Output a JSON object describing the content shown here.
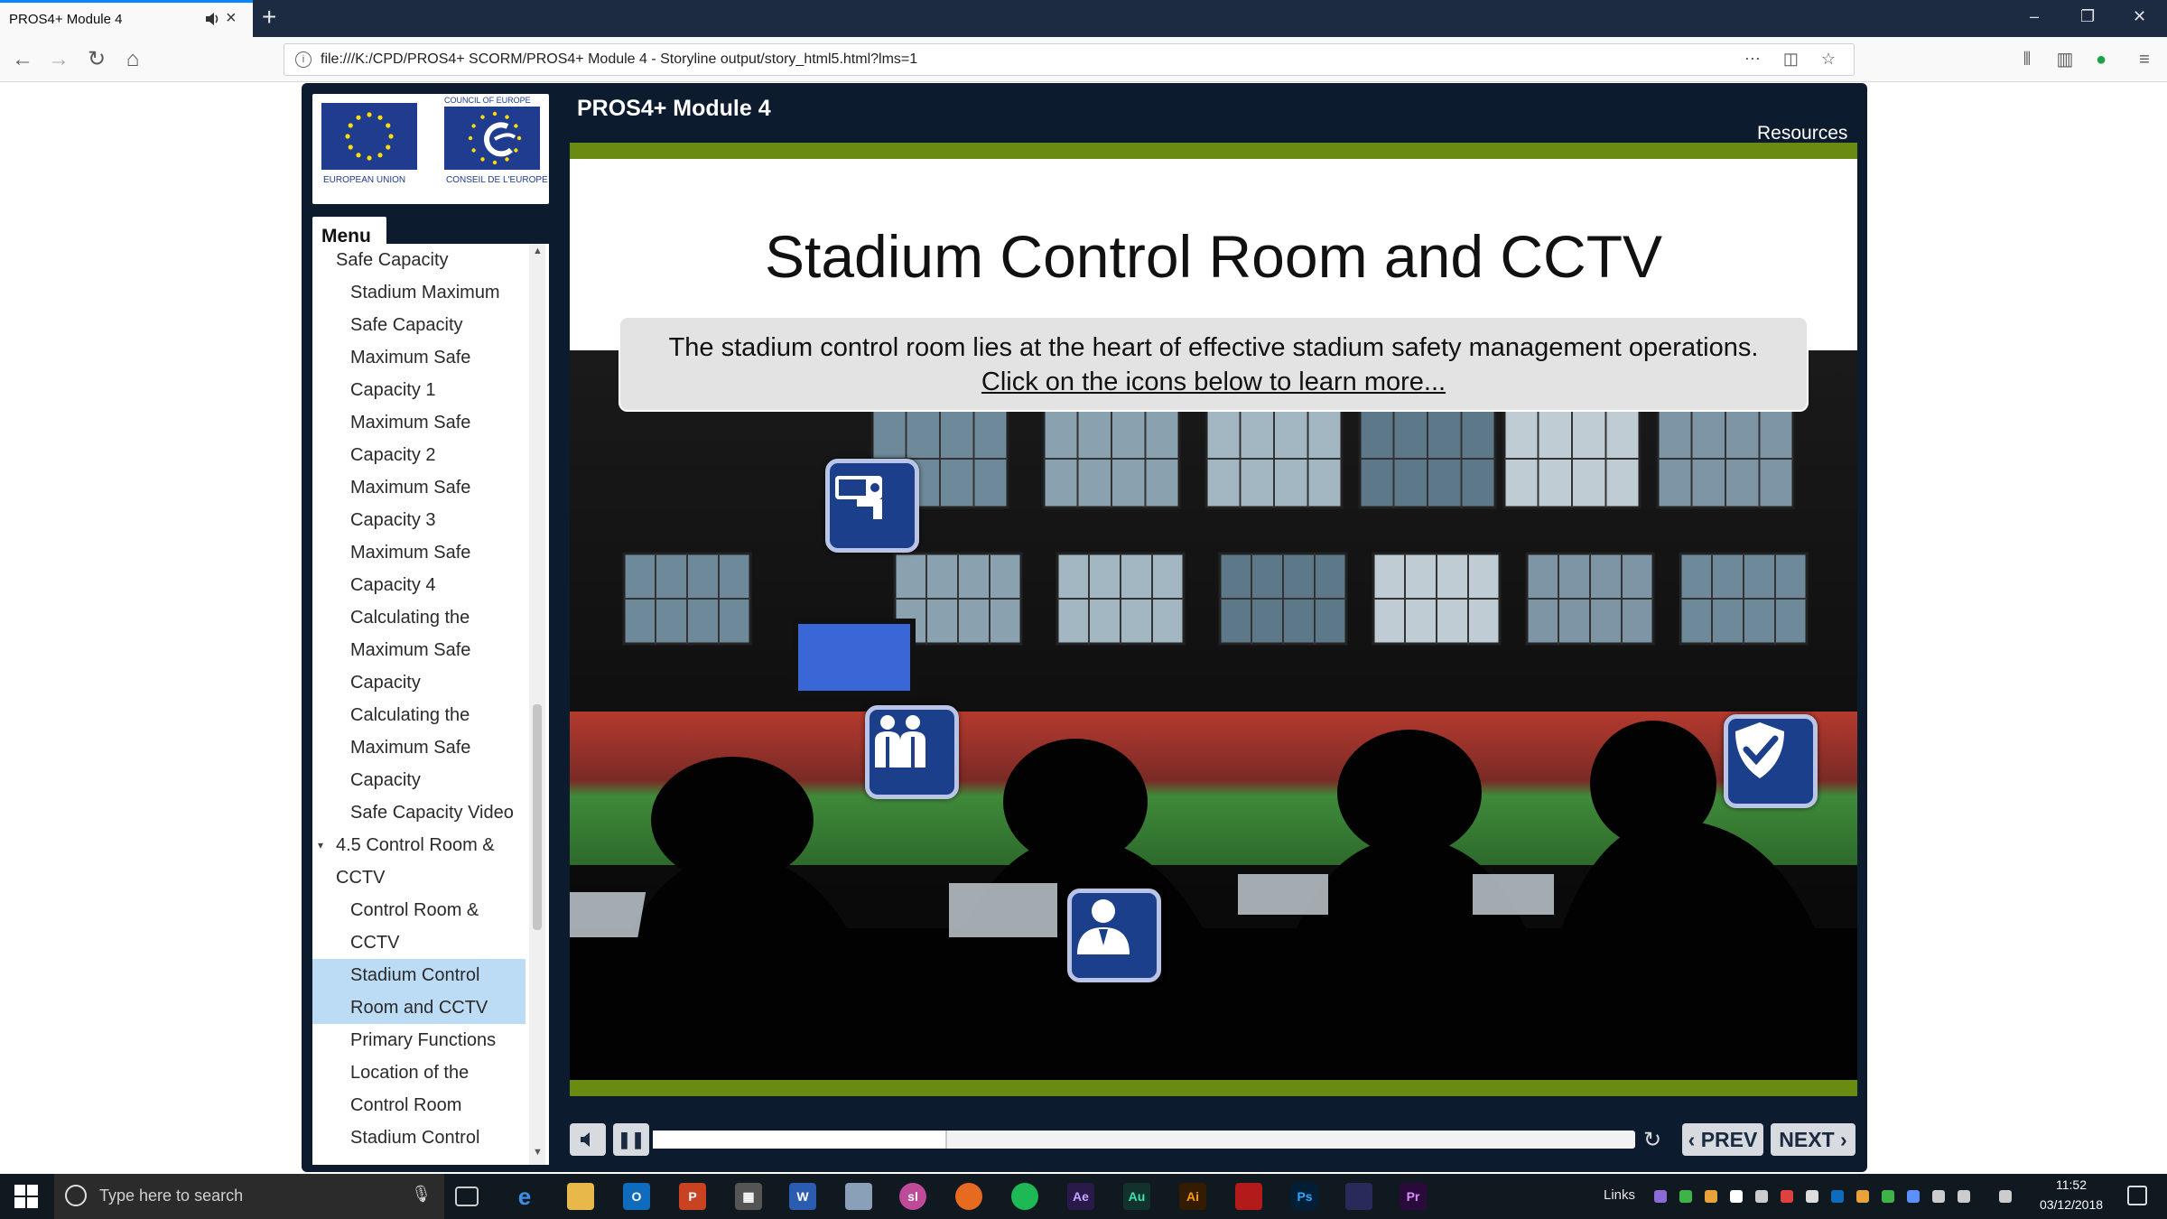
{
  "browser": {
    "tab_title": "PROS4+ Module 4",
    "url": "file:///K:/CPD/PROS4+ SCORM/PROS4+ Module 4 - Storyline output/story_html5.html?lms=1"
  },
  "logos": {
    "eu_label": "EUROPEAN UNION",
    "coe_top_label": "COUNCIL OF EUROPE",
    "coe_label": "CONSEIL DE L'EUROPE"
  },
  "player": {
    "course_title": "PROS4+ Module 4",
    "resources_label": "Resources",
    "menu_label": "Menu",
    "prev_label": "PREV",
    "next_label": "NEXT",
    "progress_fraction": 0.3
  },
  "menu": {
    "items": [
      {
        "label": "Safe Capacity",
        "level": 1
      },
      {
        "label": "Stadium Maximum Safe Capacity",
        "level": 2,
        "lines": [
          "Stadium Maximum",
          "Safe Capacity"
        ]
      },
      {
        "label": "Maximum Safe Capacity 1",
        "level": 2,
        "lines": [
          "Maximum Safe",
          "Capacity 1"
        ]
      },
      {
        "label": "Maximum Safe Capacity 2",
        "level": 2,
        "lines": [
          "Maximum Safe",
          "Capacity 2"
        ]
      },
      {
        "label": "Maximum Safe Capacity 3",
        "level": 2,
        "lines": [
          "Maximum Safe",
          "Capacity 3"
        ]
      },
      {
        "label": "Maximum Safe Capacity 4",
        "level": 2,
        "lines": [
          "Maximum Safe",
          "Capacity 4"
        ]
      },
      {
        "label": "Calculating the Maximum Safe Capacity",
        "level": 2,
        "lines": [
          "Calculating the",
          "Maximum Safe",
          "Capacity"
        ]
      },
      {
        "label": "Calculating the Maximum Safe Capacity",
        "level": 2,
        "lines": [
          "Calculating the",
          "Maximum Safe",
          "Capacity"
        ]
      },
      {
        "label": "Safe Capacity Video",
        "level": 2,
        "lines": [
          "Safe Capacity Video"
        ]
      },
      {
        "label": "4.5 Control Room & CCTV",
        "level": 1,
        "lines": [
          "4.5 Control Room &",
          "CCTV"
        ],
        "expanded": true
      },
      {
        "label": "Control Room & CCTV",
        "level": 2,
        "lines": [
          "Control Room &",
          "CCTV"
        ]
      },
      {
        "label": "Stadium Control Room and CCTV",
        "level": 2,
        "lines": [
          "Stadium Control",
          "Room and CCTV"
        ],
        "selected": true
      },
      {
        "label": "Primary Functions",
        "level": 2,
        "lines": [
          "Primary Functions"
        ]
      },
      {
        "label": "Location of the Control Room",
        "level": 2,
        "lines": [
          "Location of the",
          "Control Room"
        ]
      },
      {
        "label": "Stadium Control",
        "level": 2,
        "lines": [
          "Stadium Control"
        ]
      }
    ]
  },
  "slide": {
    "title": "Stadium Control Room and CCTV",
    "intro_text": "The stadium control room lies at the heart of effective stadium safety management operations.",
    "intro_link": "Click on the icons below to learn more...",
    "hotspots": [
      {
        "name": "cctv-camera-icon"
      },
      {
        "name": "people-group-icon"
      },
      {
        "name": "shield-check-icon"
      },
      {
        "name": "operator-person-icon"
      }
    ]
  },
  "taskbar": {
    "search_placeholder": "Type here to search",
    "links_label": "Links",
    "time": "11:52",
    "date": "03/12/2018"
  },
  "colors": {
    "player_bg": "#0d1b2e",
    "accent_green": "#6a8a12",
    "hotspot_blue": "#1c3f8c",
    "menu_selected": "#bcdcf6"
  }
}
